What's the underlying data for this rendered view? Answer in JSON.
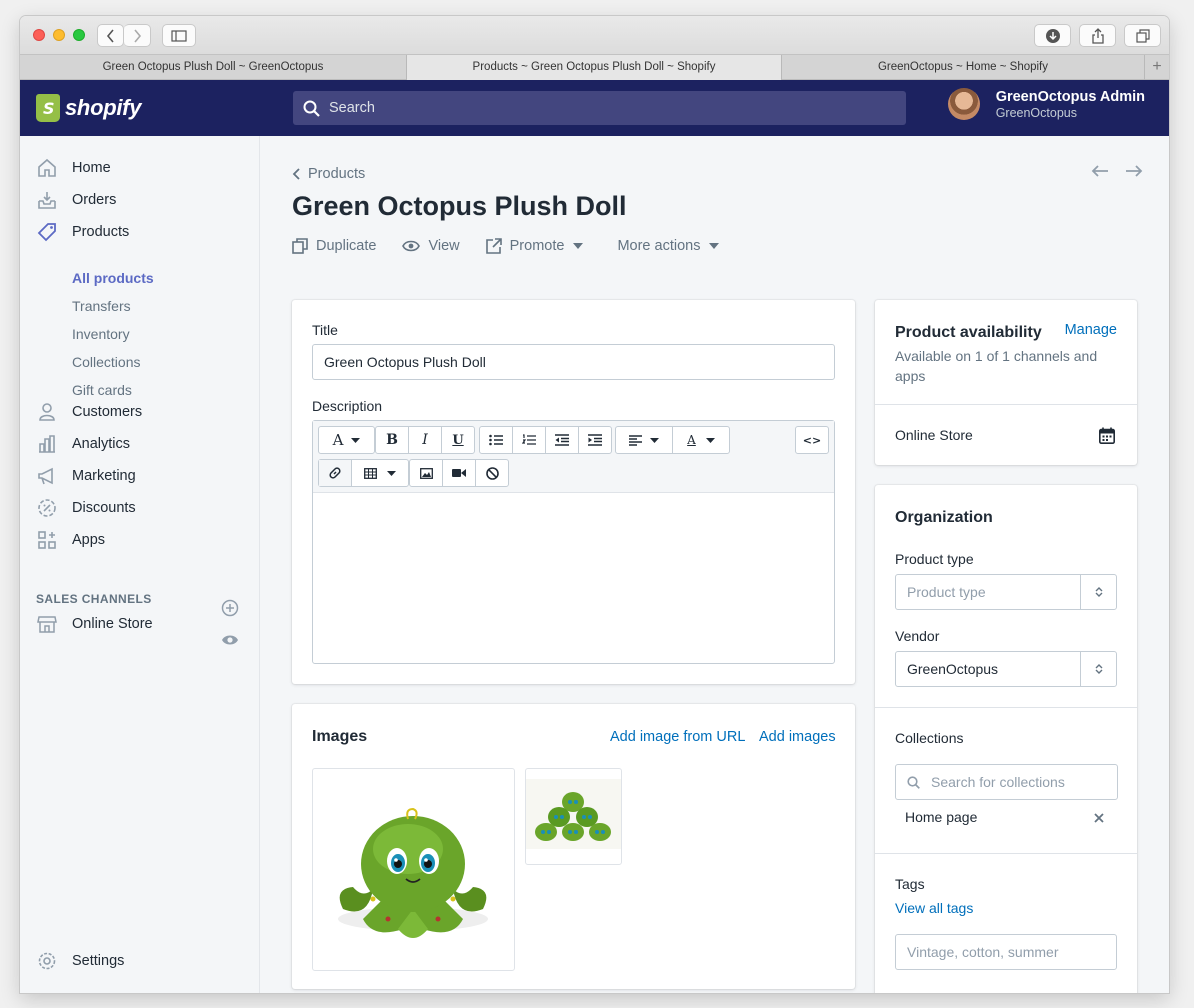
{
  "browser": {
    "tabs": [
      {
        "label": "Green Octopus Plush Doll ~ GreenOctopus"
      },
      {
        "label": "Products ~ Green Octopus Plush Doll ~ Shopify"
      },
      {
        "label": "GreenOctopus ~ Home ~ Shopify"
      }
    ],
    "new_tab": "+"
  },
  "topbar": {
    "logo_text": "shopify",
    "logo_letter": "S",
    "search_placeholder": "Search",
    "user_name": "GreenOctopus Admin",
    "user_shop": "GreenOctopus"
  },
  "sidebar": {
    "items": [
      {
        "label": "Home",
        "icon": "home-icon"
      },
      {
        "label": "Orders",
        "icon": "orders-icon"
      },
      {
        "label": "Products",
        "icon": "tag-icon"
      },
      {
        "label": "Customers",
        "icon": "person-icon"
      },
      {
        "label": "Analytics",
        "icon": "bar-chart-icon"
      },
      {
        "label": "Marketing",
        "icon": "megaphone-icon"
      },
      {
        "label": "Discounts",
        "icon": "discount-icon"
      },
      {
        "label": "Apps",
        "icon": "apps-icon"
      }
    ],
    "product_subitems": [
      {
        "label": "All products",
        "active": true
      },
      {
        "label": "Transfers"
      },
      {
        "label": "Inventory"
      },
      {
        "label": "Collections"
      },
      {
        "label": "Gift cards"
      }
    ],
    "sales_channels_title": "SALES CHANNELS",
    "online_store": "Online Store",
    "settings": "Settings"
  },
  "page": {
    "breadcrumb": "Products",
    "title": "Green Octopus Plush Doll",
    "actions": {
      "duplicate": "Duplicate",
      "view": "View",
      "promote": "Promote",
      "more": "More actions"
    }
  },
  "details_card": {
    "title_label": "Title",
    "title_value": "Green Octopus Plush Doll",
    "description_label": "Description",
    "html_toggle": "<>"
  },
  "images_card": {
    "title": "Images",
    "add_from_url": "Add image from URL",
    "add_images": "Add images"
  },
  "availability_card": {
    "title": "Product availability",
    "manage": "Manage",
    "summary": "Available on 1 of 1 channels and apps",
    "channel": "Online Store"
  },
  "organization_card": {
    "title": "Organization",
    "product_type_label": "Product type",
    "product_type_placeholder": "Product type",
    "vendor_label": "Vendor",
    "vendor_value": "GreenOctopus",
    "collections_label": "Collections",
    "collections_placeholder": "Search for collections",
    "collection_chip": "Home page",
    "tags_label": "Tags",
    "view_all_tags": "View all tags",
    "tags_placeholder": "Vintage, cotton, summer"
  },
  "colors": {
    "nav_bg": "#1c2260",
    "accent": "#5c6ac4",
    "link": "#006fbb",
    "brand_green": "#95bf47"
  }
}
